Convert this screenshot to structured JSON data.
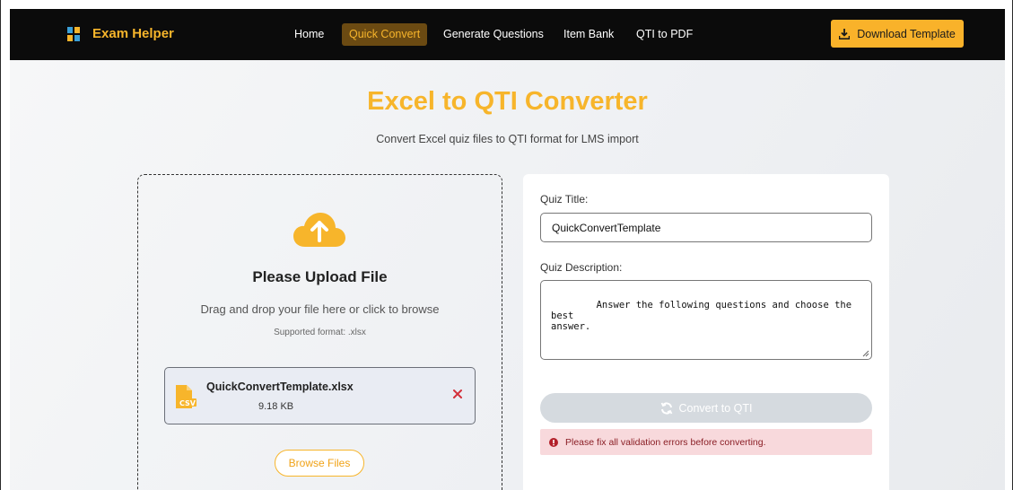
{
  "navbar": {
    "brand": "Exam Helper",
    "links": [
      {
        "label": "Home",
        "active": false
      },
      {
        "label": "Quick Convert",
        "active": true
      },
      {
        "label": "Generate Questions",
        "active": false
      },
      {
        "label": "Item Bank",
        "active": false
      },
      {
        "label": "QTI to PDF",
        "active": false
      }
    ],
    "download_label": "Download Template"
  },
  "page": {
    "title": "Excel to QTI Converter",
    "subtitle": "Convert Excel quiz files to QTI format for LMS import"
  },
  "upload": {
    "icon": "cloud-upload-icon",
    "title": "Please Upload File",
    "hint": "Drag and drop your file here or click to browse",
    "format": "Supported format: .xlsx",
    "file": {
      "name": "QuickConvertTemplate.xlsx",
      "size": "9.18 KB",
      "icon": "csv-file-icon"
    },
    "browse_label": "Browse Files"
  },
  "form": {
    "title_label": "Quiz Title:",
    "title_value": "QuickConvertTemplate",
    "description_label": "Quiz Description:",
    "description_value": "Answer the following questions and choose the best\nanswer.",
    "convert_label": "Convert to QTI",
    "error_text": "Please fix all validation errors before converting."
  },
  "colors": {
    "accent": "#f7b52b",
    "navbar_bg": "#0b0b0b",
    "error_bg": "#f8d9dc",
    "error_text": "#8a1e25",
    "disabled_button": "#d5dadf"
  }
}
